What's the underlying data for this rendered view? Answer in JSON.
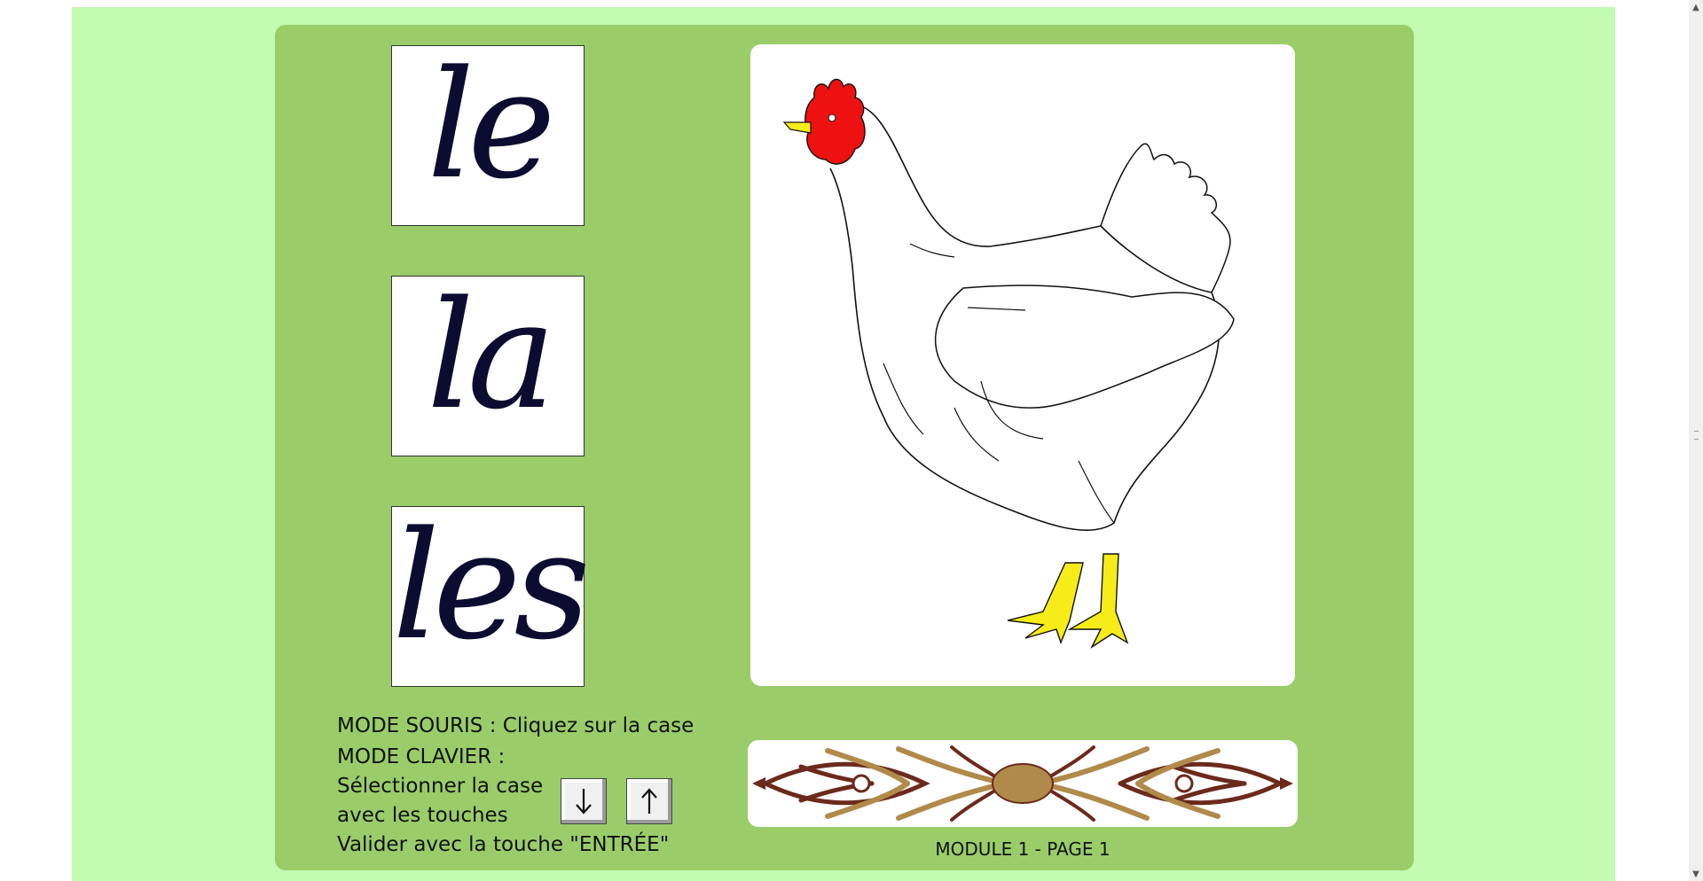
{
  "cards": [
    {
      "word": "le"
    },
    {
      "word": "la"
    },
    {
      "word": "les"
    }
  ],
  "image": {
    "subject": "hen-illustration"
  },
  "instructions": {
    "mouse_mode": "MODE SOURIS : Cliquez sur la case",
    "keyboard_mode": "MODE CLAVIER :",
    "select_line1": "Sélectionner la case",
    "select_line2": "avec les touches",
    "validate": "Valider avec la touche \"ENTRÉE\""
  },
  "keys": {
    "down": "down-arrow-icon",
    "up": "up-arrow-icon"
  },
  "footer": {
    "label": "MODULE 1 - PAGE 1"
  },
  "colors": {
    "outer_bg": "#c2fbb1",
    "panel_bg": "#9acd6a",
    "ink": "#0c0b30",
    "comb": "#ee1111",
    "feet": "#f5ec1a",
    "ornament_brown": "#6b2a1c",
    "ornament_tan": "#b08a4a"
  }
}
